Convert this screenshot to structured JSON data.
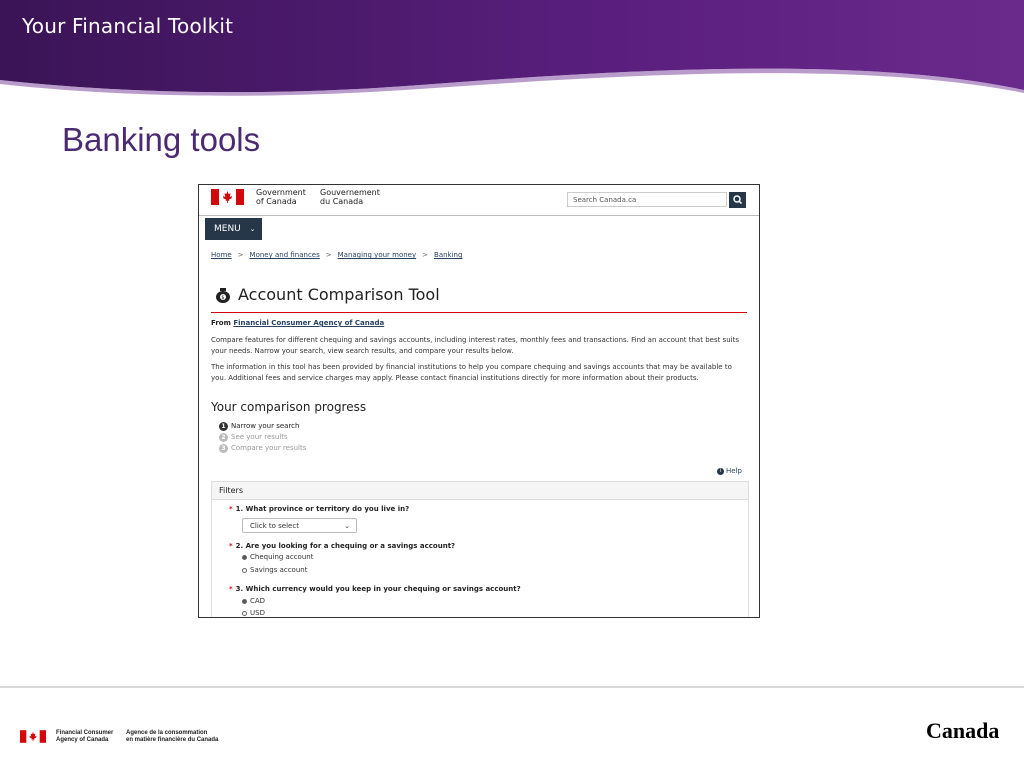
{
  "slide": {
    "banner_title": "Your Financial Toolkit",
    "title": "Banking tools",
    "colors": {
      "banner_dark": "#3a1456",
      "banner_light": "#6a2a8c",
      "title": "#4b2a72"
    }
  },
  "screenshot": {
    "gov_en": [
      "Government",
      "of Canada"
    ],
    "gov_fr": [
      "Gouvernement",
      "du Canada"
    ],
    "search_placeholder": "Search Canada.ca",
    "menu_label": "MENU",
    "breadcrumbs": [
      "Home",
      "Money and finances",
      "Managing your money",
      "Banking"
    ],
    "tool_title": "Account Comparison Tool",
    "from_label": "From",
    "from_link": "Financial Consumer Agency of Canada",
    "para1": "Compare features for different chequing and savings accounts, including interest rates, monthly fees and transactions. Find an account that best suits your needs. Narrow your search, view search results, and compare your results below.",
    "para2": "The information in this tool has been provided by financial institutions to help you compare chequing and savings accounts that may be available to you. Additional fees and service charges may apply. Please contact financial institutions directly for more information about their products.",
    "progress_heading": "Your comparison progress",
    "steps": [
      {
        "num": "1",
        "label": "Narrow your search"
      },
      {
        "num": "2",
        "label": "See your results"
      },
      {
        "num": "3",
        "label": "Compare your results"
      }
    ],
    "help_label": "Help",
    "filters_heading": "Filters",
    "q1": "1. What province or territory do you live in?",
    "q1_select": "Click to select",
    "q2": "2. Are you looking for a chequing or a savings account?",
    "q2_options": [
      "Chequing account",
      "Savings account"
    ],
    "q3": "3. Which currency would you keep in your chequing or savings account?",
    "q3_options": [
      "CAD",
      "USD"
    ],
    "colors": {
      "nav": "#26374a",
      "link": "#284162",
      "accent_red": "#d3080c"
    }
  },
  "footer": {
    "fcac_en": [
      "Financial Consumer",
      "Agency of Canada"
    ],
    "fcac_fr": [
      "Agence de la consommation",
      "en matière financière du Canada"
    ],
    "wordmark": "Canada"
  }
}
